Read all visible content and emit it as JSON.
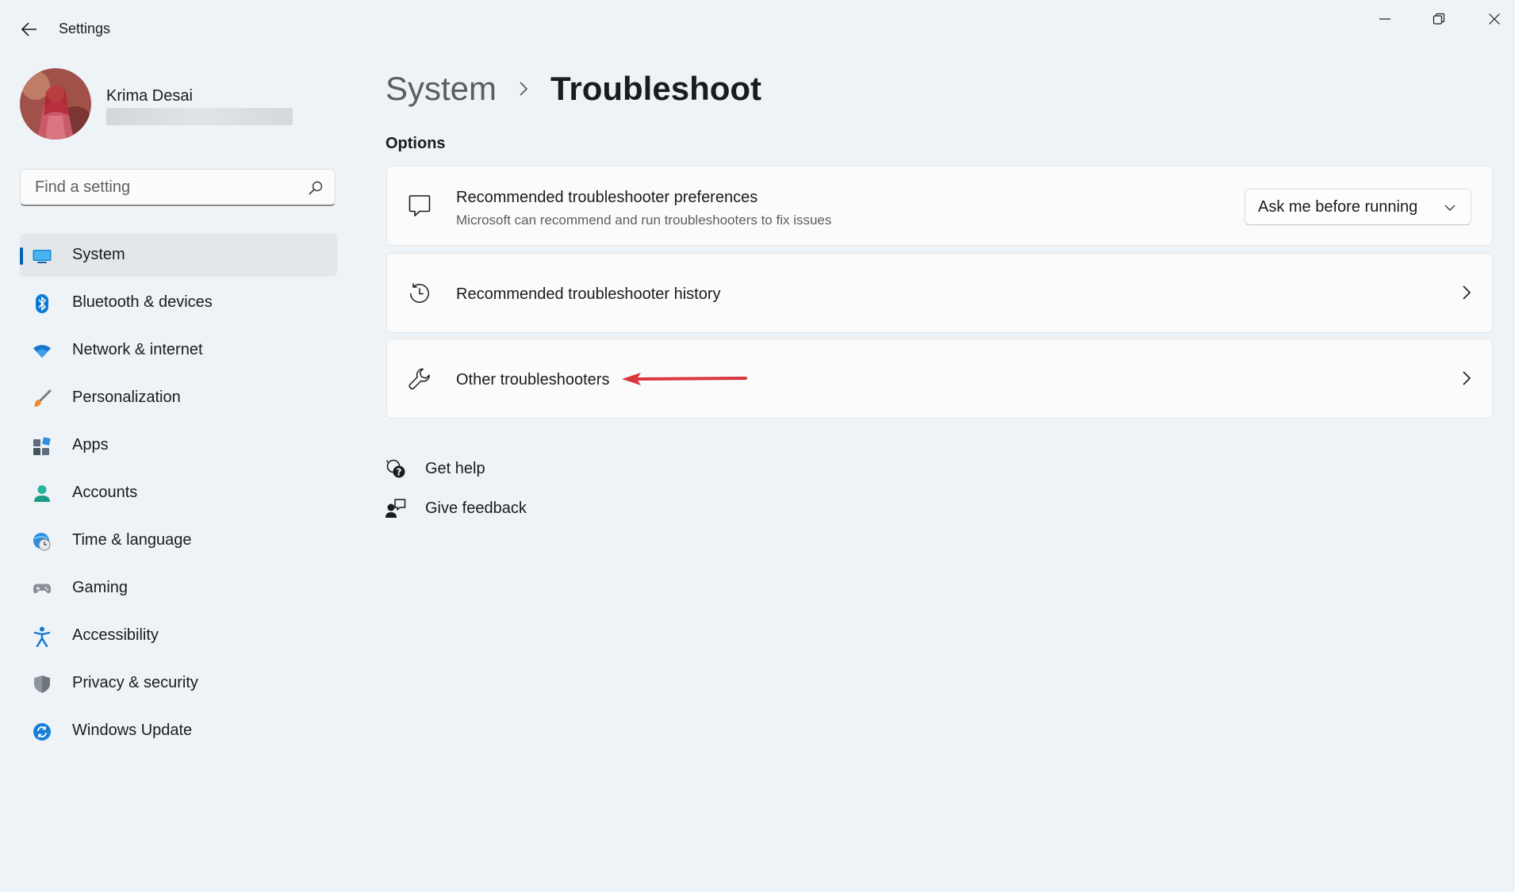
{
  "window": {
    "title": "Settings",
    "back_label": "Back",
    "min_label": "Minimize",
    "max_label": "Restore",
    "close_label": "Close"
  },
  "profile": {
    "name": "Krima Desai",
    "email": ""
  },
  "search": {
    "placeholder": "Find a setting"
  },
  "sidebar": {
    "items": [
      {
        "label": "System",
        "icon": "system-icon",
        "active": true
      },
      {
        "label": "Bluetooth & devices",
        "icon": "bluetooth-icon"
      },
      {
        "label": "Network & internet",
        "icon": "wifi-icon"
      },
      {
        "label": "Personalization",
        "icon": "brush-icon"
      },
      {
        "label": "Apps",
        "icon": "apps-icon"
      },
      {
        "label": "Accounts",
        "icon": "account-icon"
      },
      {
        "label": "Time & language",
        "icon": "clock-globe-icon"
      },
      {
        "label": "Gaming",
        "icon": "gamepad-icon"
      },
      {
        "label": "Accessibility",
        "icon": "accessibility-icon"
      },
      {
        "label": "Privacy & security",
        "icon": "shield-icon"
      },
      {
        "label": "Windows Update",
        "icon": "update-icon"
      }
    ]
  },
  "breadcrumb": {
    "parent": "System",
    "current": "Troubleshoot"
  },
  "main": {
    "section_label": "Options",
    "cards": [
      {
        "title": "Recommended troubleshooter preferences",
        "subtitle": "Microsoft can recommend and run troubleshooters to fix issues",
        "icon": "chat-bubble-icon",
        "dropdown_value": "Ask me before running"
      },
      {
        "title": "Recommended troubleshooter history",
        "icon": "history-icon"
      },
      {
        "title": "Other troubleshooters",
        "icon": "wrench-icon"
      }
    ],
    "links": [
      {
        "label": "Get help",
        "icon": "help-icon"
      },
      {
        "label": "Give feedback",
        "icon": "feedback-icon"
      }
    ]
  },
  "colors": {
    "accent": "#005fb8",
    "background": "#eef3f8",
    "annotation_arrow": "#d9363e"
  }
}
